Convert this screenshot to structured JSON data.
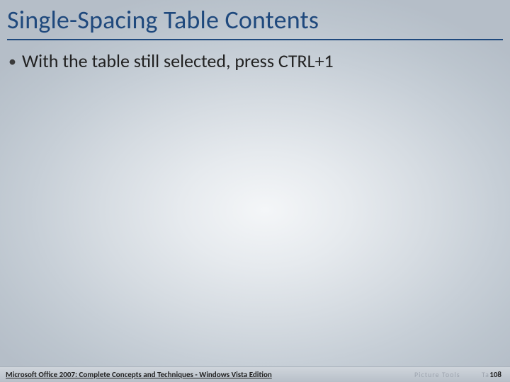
{
  "title": "Single-Spacing Table Contents",
  "bullets": [
    "With the table still selected, press CTRL+1"
  ],
  "footer": {
    "left": "Microsoft Office 2007: Complete Concepts and Techniques - Windows Vista Edition",
    "page": "108"
  },
  "faint": {
    "a": "",
    "b": "Picture Tools",
    "c": "Ta"
  }
}
